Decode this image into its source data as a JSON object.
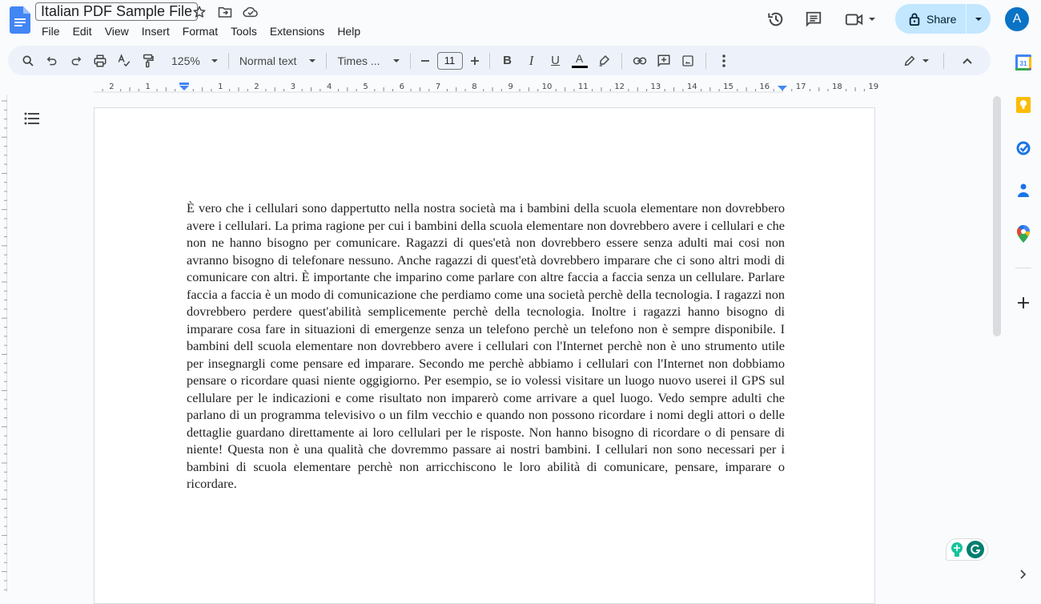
{
  "app": {
    "doc_title": "Italian PDF Sample File",
    "menu": [
      "File",
      "Edit",
      "View",
      "Insert",
      "Format",
      "Tools",
      "Extensions",
      "Help"
    ],
    "share_label": "Share",
    "avatar_letter": "A"
  },
  "toolbar": {
    "zoom": "125%",
    "style": "Normal text",
    "font": "Times ...",
    "font_size": "11",
    "text_color": "#000000",
    "icons": [
      "search-icon",
      "undo-icon",
      "redo-icon",
      "print-icon",
      "spellcheck-icon",
      "paint-format-icon",
      "minus-icon",
      "plus-icon",
      "bold-icon",
      "italic-icon",
      "underline-icon",
      "text-color-icon",
      "highlight-icon",
      "link-icon",
      "add-comment-icon",
      "image-icon",
      "more-icon",
      "editing-mode-icon",
      "collapse-menus-icon"
    ]
  },
  "ruler": {
    "left_labels": [
      "2",
      "1"
    ],
    "right_labels": [
      "1",
      "2",
      "3",
      "4",
      "5",
      "6",
      "7",
      "8",
      "9",
      "10",
      "11",
      "12",
      "13",
      "14",
      "15",
      "16",
      "17",
      "18",
      "19"
    ]
  },
  "document": {
    "body": "È vero che i cellulari sono dappertutto nella nostra società ma i bambini della scuola elementare non dovrebbero avere i cellulari. La prima ragione per cui i bambini della scuola elementare non dovrebbero avere i cellulari e che non ne hanno bisogno per comunicare. Ragazzi di ques'età non dovrebbero essere senza adulti mai cosi non avranno bisogno di telefonare nessuno. Anche ragazzi di quest'età dovrebbero imparare che ci sono altri modi di comunicare con altri. È importante che imparino come parlare con altre faccia a faccia senza un cellulare. Parlare faccia a faccia è un modo di comunicazione che perdiamo come una società perchè della tecnologia. I ragazzi non dovrebbero perdere quest'abilità semplicemente perchè della tecnologia. Inoltre i ragazzi hanno bisogno di imparare cosa fare in situazioni di emergenze senza un telefono perchè un telefono non è sempre disponibile. I bambini dell scuola elementare non dovrebbero avere i cellulari con l'Internet perchè non è uno strumento utile per insegnargli come pensare ed imparare. Secondo me perchè abbiamo i cellulari con l'Internet non dobbiamo pensare o ricordare quasi niente oggigiorno. Per esempio, se io volessi visitare un luogo nuovo userei il GPS sul cellulare per le indicazioni e come risultato non imparerò come arrivare a quel luogo. Vedo sempre adulti che parlano di un programma televisivo o un film vecchio e quando non possono ricordare i nomi degli attori o delle dettaglie guardano direttamente ai loro cellulari per le risposte. Non hanno bisogno di ricordare o di pensare di niente! Questa non è una qualità che dovremmo passare ai nostri bambini. I cellulari non sono necessari per i bambini di scuola elementare perchè non arricchiscono le loro abilità di comunicare, pensare, imparare o ricordare."
  },
  "side_panel": {
    "calendar_day": "31",
    "apps": [
      "calendar-icon",
      "keep-icon",
      "tasks-icon",
      "contacts-icon",
      "maps-icon",
      "add-addon-icon"
    ]
  },
  "colors": {
    "share_bg": "#c2e7ff",
    "avatar_bg": "#0b73c5",
    "toolbar_bg": "#edf2fa",
    "docs_blue": "#4285f4",
    "grammarly_green": "#15c39a"
  }
}
